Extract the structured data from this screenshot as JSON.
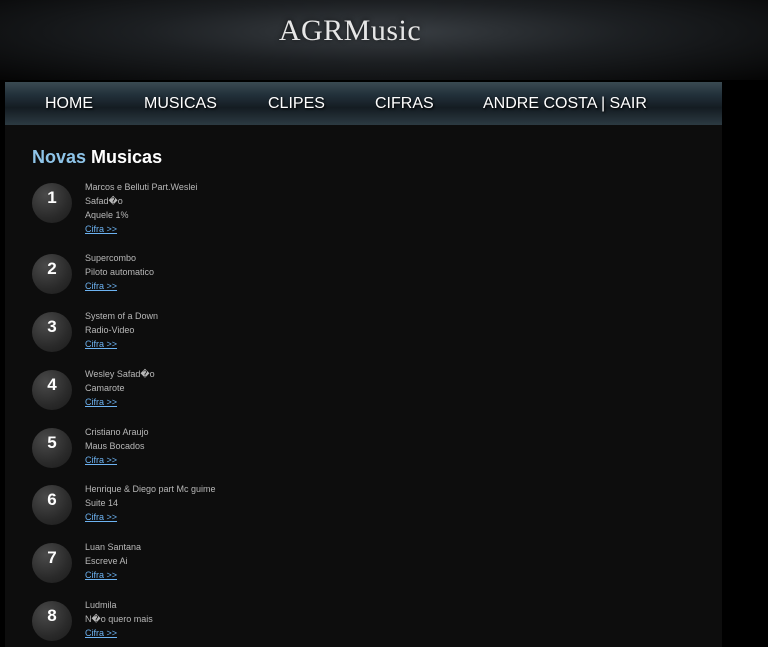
{
  "site": {
    "title": "AGRMusic"
  },
  "nav": {
    "items": [
      {
        "label": "HOME"
      },
      {
        "label": "MUSICAS"
      },
      {
        "label": "CLIPES"
      },
      {
        "label": "CIFRAS"
      },
      {
        "label": "ANDRE COSTA | SAIR"
      }
    ]
  },
  "section": {
    "title_part1": "Novas",
    "title_part2": "Musicas"
  },
  "entries": [
    {
      "number": "1",
      "lines": [
        "Marcos e Belluti Part.Weslei",
        "Safad�o",
        "Aquele 1%"
      ],
      "link": "Cifra >>"
    },
    {
      "number": "2",
      "lines": [
        "Supercombo",
        "Piloto automatico"
      ],
      "link": "Cifra >>"
    },
    {
      "number": "3",
      "lines": [
        "System of a Down",
        "Radio-Video"
      ],
      "link": "Cifra >>"
    },
    {
      "number": "4",
      "lines": [
        "Wesley Safad�o",
        "Camarote"
      ],
      "link": "Cifra >>"
    },
    {
      "number": "5",
      "lines": [
        "Cristiano Araujo",
        "Maus Bocados"
      ],
      "link": "Cifra >>"
    },
    {
      "number": "6",
      "lines": [
        "Henrique & Diego part Mc guime",
        "Suite 14"
      ],
      "link": "Cifra >>"
    },
    {
      "number": "7",
      "lines": [
        "Luan Santana",
        "Escreve Ai"
      ],
      "link": "Cifra >>"
    },
    {
      "number": "8",
      "lines": [
        "Ludmila",
        "N�o quero mais"
      ],
      "link": "Cifra >>"
    }
  ]
}
